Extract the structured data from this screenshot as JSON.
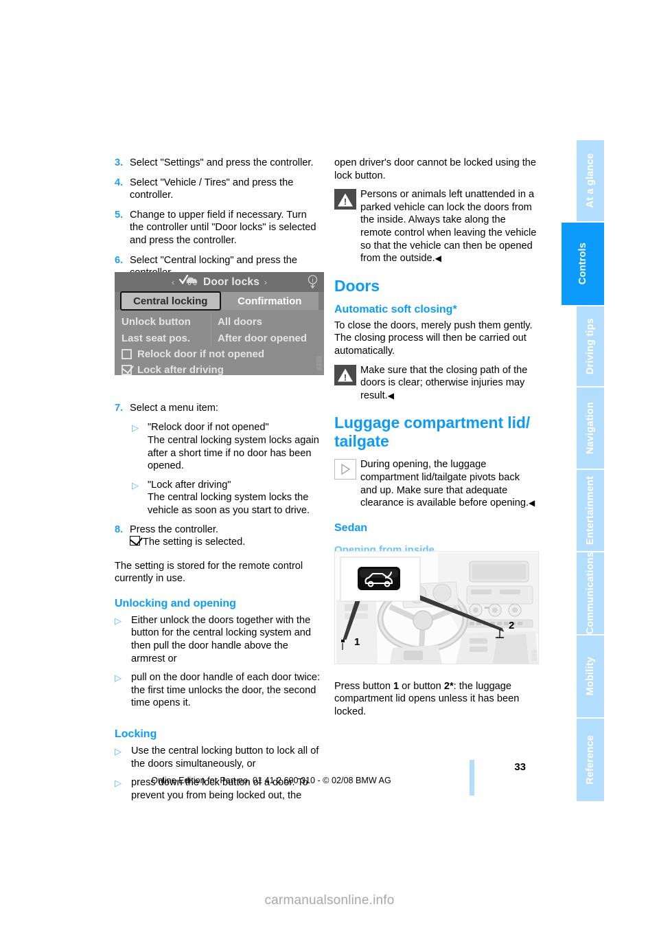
{
  "document": {
    "page_number": "33",
    "edition_line": "Online Edition for Part no. 01 41 2 600 310 - © 02/08 BMW AG",
    "watermark": "carmanualsonline.info"
  },
  "sidebar": {
    "tabs": [
      {
        "label": "At a glance",
        "active": false
      },
      {
        "label": "Controls",
        "active": true
      },
      {
        "label": "Driving tips",
        "active": false
      },
      {
        "label": "Navigation",
        "active": false
      },
      {
        "label": "Entertainment",
        "active": false
      },
      {
        "label": "Communications",
        "active": false
      },
      {
        "label": "Mobility",
        "active": false
      },
      {
        "label": "Reference",
        "active": false
      }
    ]
  },
  "left_column": {
    "steps": [
      {
        "num": "3.",
        "text": "Select \"Settings\" and press the controller."
      },
      {
        "num": "4.",
        "text": "Select \"Vehicle / Tires\" and press the controller."
      },
      {
        "num": "5.",
        "text": "Change to upper field if necessary. Turn the controller until \"Door locks\" is selected and press the controller."
      },
      {
        "num": "6.",
        "text": "Select \"Central locking\" and press the controller."
      }
    ],
    "step7": {
      "num": "7.",
      "text": "Select a menu item:",
      "items": [
        {
          "title": "\"Relock door if not opened\"",
          "body": "The central locking system locks again after a short time if no door has been opened."
        },
        {
          "title": "\"Lock after driving\"",
          "body": "The central locking system locks the vehicle as soon as you start to drive."
        }
      ]
    },
    "step8": {
      "num": "8.",
      "text": "Press the controller.",
      "result": "The setting is selected."
    },
    "stored_note": "The setting is stored for the remote control currently in use.",
    "unlocking": {
      "heading": "Unlocking and opening",
      "bullets": [
        "Either unlock the doors together with the button for the central locking system and then pull the door handle above the armrest or",
        "pull on the door handle of each door twice: the first time unlocks the door, the second time opens it."
      ]
    },
    "locking": {
      "heading": "Locking",
      "bullets": [
        "Use the central locking button to lock all of the doors simultaneously, or",
        "press down the lock button of a door. To prevent you from being locked out, the"
      ]
    }
  },
  "idrive_figure": {
    "header_title": "Door locks",
    "left_arrow": "‹",
    "right_arrow": "›",
    "tabs": [
      {
        "label": "Central locking",
        "selected": true
      },
      {
        "label": "Confirmation",
        "selected": false
      }
    ],
    "rows": [
      {
        "label": "Unlock button",
        "value": "All doors"
      },
      {
        "label": "Last seat pos.",
        "value": "After door opened"
      }
    ],
    "checkboxes": [
      {
        "label": "Relock door if not opened",
        "checked": false
      },
      {
        "label": "Lock after driving",
        "checked": true
      }
    ]
  },
  "right_column": {
    "continued_text": "open driver's door cannot be locked using the lock button.",
    "warning_locked_in": "Persons or animals left unattended in a parked vehicle can lock the doors from the inside. Always take along the remote control when leaving the vehicle so that the vehicle can then be opened from the outside.",
    "doors": {
      "heading": "Doors",
      "subheading": "Automatic soft closing*",
      "body": "To close the doors, merely push them gently. The closing process will then be carried out automatically.",
      "warning": "Make sure that the closing path of the doors is clear; otherwise injuries may result."
    },
    "luggage": {
      "heading": "Luggage compartment lid/ tailgate",
      "note": "During opening, the luggage compartment lid/tailgate pivots back and up. Make sure that adequate clearance is available before opening.",
      "sedan_heading": "Sedan",
      "opening_heading": "Opening from inside",
      "callouts": [
        "1",
        "2"
      ],
      "caption_pre": "Press button ",
      "caption_num1": "1",
      "caption_mid": " or button ",
      "caption_num2": "2*",
      "caption_post": ": the luggage compartment lid opens unless it has been locked."
    }
  },
  "colors": {
    "accent_blue": "#0c9bfb",
    "light_blue": "#b3ddfc",
    "mid_blue": "#6ec3fb",
    "warning_gray": "#4a4a4a"
  }
}
